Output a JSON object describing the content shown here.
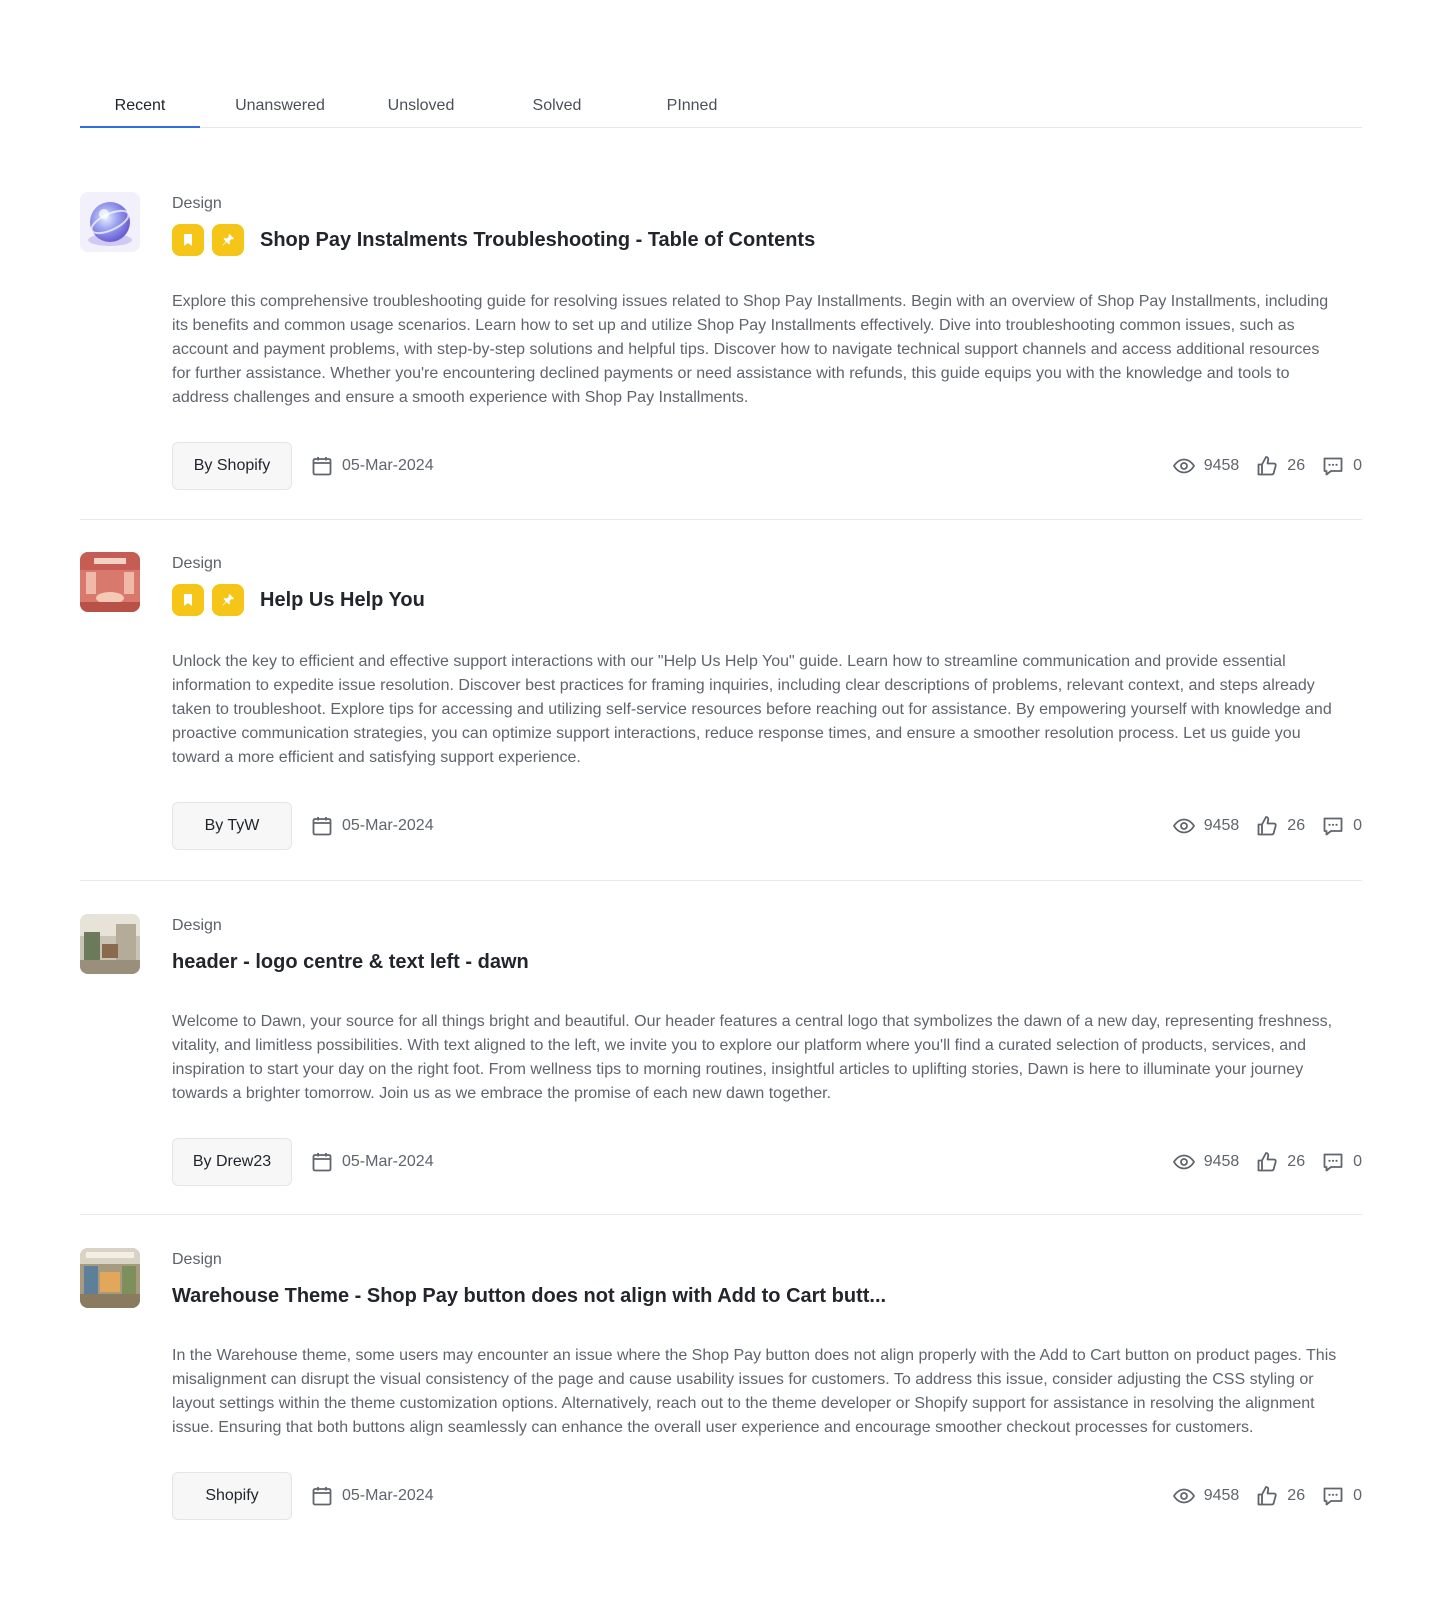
{
  "tabs": [
    {
      "label": "Recent",
      "active": true
    },
    {
      "label": "Unanswered",
      "active": false
    },
    {
      "label": "Unsloved",
      "active": false
    },
    {
      "label": "Solved",
      "active": false
    },
    {
      "label": "PInned",
      "active": false
    }
  ],
  "posts": [
    {
      "category": "Design",
      "title": "Shop Pay Instalments Troubleshooting - Table of Contents",
      "description": "Explore this comprehensive troubleshooting guide for resolving issues related to Shop Pay Installments. Begin with an overview of Shop Pay Installments, including its benefits and common usage scenarios. Learn how to set up and utilize Shop Pay Installments effectively. Dive into troubleshooting common issues, such as account and payment problems, with step-by-step solutions and helpful tips. Discover how to navigate technical support channels and access additional resources for further assistance. Whether you're encountering declined payments or need assistance with refunds, this guide equips you with the knowledge and tools to address challenges and ensure a smooth experience with Shop Pay Installments.",
      "author": "By Shopify",
      "date": "05-Mar-2024",
      "views": "9458",
      "likes": "26",
      "comments": "0"
    },
    {
      "category": "Design",
      "title": "Help Us Help You",
      "description": "Unlock the key to efficient and effective support interactions with our \"Help Us Help You\" guide. Learn how to streamline communication and provide essential information to expedite issue resolution. Discover best practices for framing inquiries, including clear descriptions of problems, relevant context, and steps already taken to troubleshoot. Explore tips for accessing and utilizing self-service resources before reaching out for assistance. By empowering yourself with knowledge and proactive communication strategies, you can optimize support interactions, reduce response times, and ensure a smoother resolution process. Let us guide you toward a more efficient and satisfying support experience.",
      "author": "By TyW",
      "date": "05-Mar-2024",
      "views": "9458",
      "likes": "26",
      "comments": "0"
    },
    {
      "category": "Design",
      "title": "header - logo centre & text left  - dawn",
      "description": "Welcome to Dawn, your source for all things bright and beautiful. Our header features a central logo that symbolizes the dawn of a new day, representing freshness, vitality, and limitless possibilities. With text aligned to the left, we invite you to explore our platform where you'll find a curated selection of products, services, and inspiration to start your day on the right foot. From wellness tips to morning routines, insightful articles to uplifting stories, Dawn is here to illuminate your journey towards a brighter tomorrow. Join us as we embrace the promise of each new dawn together.",
      "author": "By Drew23",
      "date": "05-Mar-2024",
      "views": "9458",
      "likes": "26",
      "comments": "0"
    },
    {
      "category": "Design",
      "title": "Warehouse Theme - Shop Pay button does not align with Add to Cart butt...",
      "description": "In the Warehouse theme, some users may encounter an issue where the Shop Pay button does not align properly with the Add to Cart button on product pages. This misalignment can disrupt the visual consistency of the page and cause usability issues for customers. To address this issue, consider adjusting the CSS styling or layout settings within the theme customization options. Alternatively, reach out to the theme developer or Shopify support for assistance in resolving the alignment issue. Ensuring that both buttons align seamlessly can enhance the overall user experience and encourage smoother checkout processes for customers.",
      "author": "Shopify",
      "date": "05-Mar-2024",
      "views": "9458",
      "likes": "26",
      "comments": "0"
    }
  ],
  "colors": {
    "accent": "#2f6fdf",
    "badge": "#f5c518"
  },
  "icons": {
    "badge_1": "bookmark-icon",
    "badge_2": "pin-icon",
    "date": "calendar-icon",
    "views": "eye-icon",
    "likes": "thumbs-up-icon",
    "comments": "comment-icon"
  }
}
